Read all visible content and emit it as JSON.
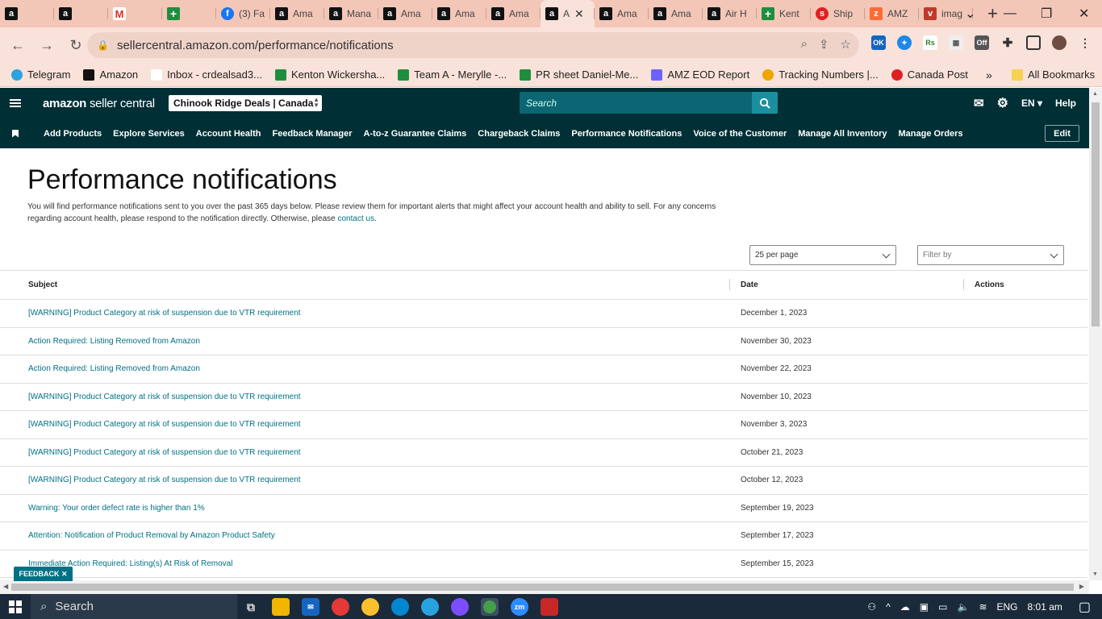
{
  "browser": {
    "tabs": [
      {
        "label": "",
        "icon": "a"
      },
      {
        "label": "",
        "icon": "a"
      },
      {
        "label": "",
        "icon": "M"
      },
      {
        "label": "",
        "icon": "+"
      },
      {
        "label": "(3) Fa",
        "icon": "f"
      },
      {
        "label": "Ama",
        "icon": "a"
      },
      {
        "label": "Mana",
        "icon": "a"
      },
      {
        "label": "Ama",
        "icon": "a"
      },
      {
        "label": "Ama",
        "icon": "a"
      },
      {
        "label": "Ama",
        "icon": "a"
      },
      {
        "label": "A",
        "icon": "a",
        "active": true
      },
      {
        "label": "Ama",
        "icon": "a"
      },
      {
        "label": "Ama",
        "icon": "a"
      },
      {
        "label": "Air H",
        "icon": "a"
      },
      {
        "label": "Kent",
        "icon": "+"
      },
      {
        "label": "Ship",
        "icon": "s"
      },
      {
        "label": "AMZ",
        "icon": "z"
      },
      {
        "label": "imag",
        "icon": "v"
      }
    ],
    "url": "sellercentral.amazon.com/performance/notifications",
    "bookmarks": [
      {
        "label": "Telegram"
      },
      {
        "label": "Amazon"
      },
      {
        "label": "Inbox - crdealsad3..."
      },
      {
        "label": "Kenton Wickersha..."
      },
      {
        "label": "Team A - Merylle -..."
      },
      {
        "label": "PR sheet Daniel-Me..."
      },
      {
        "label": "AMZ EOD Report"
      },
      {
        "label": "Tracking Numbers |..."
      },
      {
        "label": "Canada Post"
      }
    ],
    "all_bookmarks": "All Bookmarks"
  },
  "header": {
    "logo_brand": "amazon",
    "logo_product": "seller central",
    "store": "Chinook Ridge Deals | Canada",
    "search_placeholder": "Search",
    "language": "EN",
    "help": "Help"
  },
  "nav": {
    "items": [
      "Add Products",
      "Explore Services",
      "Account Health",
      "Feedback Manager",
      "A-to-z Guarantee Claims",
      "Chargeback Claims",
      "Performance Notifications",
      "Voice of the Customer",
      "Manage All Inventory",
      "Manage Orders"
    ],
    "edit": "Edit"
  },
  "page": {
    "title": "Performance notifications",
    "intro": "You will find performance notifications sent to you over the past 365 days below. Please review them for important alerts that might affect your account health and ability to sell. For any concerns regarding account health, please respond to the notification directly. Otherwise, please ",
    "contact_link": "contact us",
    "intro_end": ".",
    "per_page": "25 per page",
    "filter_placeholder": "Filter by"
  },
  "table": {
    "headers": {
      "subject": "Subject",
      "date": "Date",
      "actions": "Actions"
    },
    "rows": [
      {
        "subject": "[WARNING] Product Category at risk of suspension due to VTR requirement",
        "date": "December 1, 2023"
      },
      {
        "subject": "Action Required: Listing Removed from Amazon",
        "date": "November 30, 2023"
      },
      {
        "subject": "Action Required: Listing Removed from Amazon",
        "date": "November 22, 2023"
      },
      {
        "subject": "[WARNING] Product Category at risk of suspension due to VTR requirement",
        "date": "November 10, 2023"
      },
      {
        "subject": "[WARNING] Product Category at risk of suspension due to VTR requirement",
        "date": "November 3, 2023"
      },
      {
        "subject": "[WARNING] Product Category at risk of suspension due to VTR requirement",
        "date": "October 21, 2023"
      },
      {
        "subject": "[WARNING] Product Category at risk of suspension due to VTR requirement",
        "date": "October 12, 2023"
      },
      {
        "subject": "Warning: Your order defect rate is higher than 1%",
        "date": "September 19, 2023"
      },
      {
        "subject": "Attention: Notification of Product Removal by Amazon Product Safety",
        "date": "September 17, 2023"
      },
      {
        "subject": "Immediate Action Required: Listing(s) At Risk of Removal",
        "date": "September 15, 2023"
      }
    ]
  },
  "feedback": "FEEDBACK",
  "taskbar": {
    "search": "Search",
    "language": "ENG",
    "time": "8:01 am"
  },
  "colors": {
    "header_bg": "#002f36",
    "link": "#007185",
    "tabstrip": "#f3c7b8"
  }
}
